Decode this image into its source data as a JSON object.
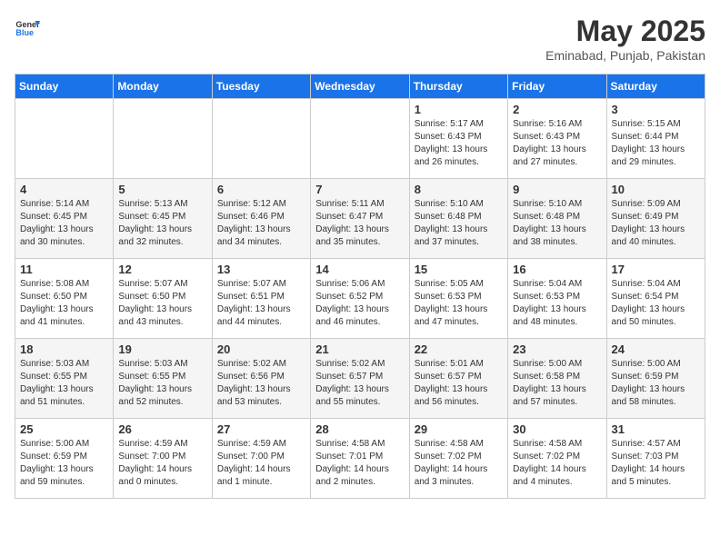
{
  "header": {
    "logo_line1": "General",
    "logo_line2": "Blue",
    "month": "May 2025",
    "location": "Eminabad, Punjab, Pakistan"
  },
  "weekdays": [
    "Sunday",
    "Monday",
    "Tuesday",
    "Wednesday",
    "Thursday",
    "Friday",
    "Saturday"
  ],
  "weeks": [
    [
      {
        "day": "",
        "info": ""
      },
      {
        "day": "",
        "info": ""
      },
      {
        "day": "",
        "info": ""
      },
      {
        "day": "",
        "info": ""
      },
      {
        "day": "1",
        "info": "Sunrise: 5:17 AM\nSunset: 6:43 PM\nDaylight: 13 hours\nand 26 minutes."
      },
      {
        "day": "2",
        "info": "Sunrise: 5:16 AM\nSunset: 6:43 PM\nDaylight: 13 hours\nand 27 minutes."
      },
      {
        "day": "3",
        "info": "Sunrise: 5:15 AM\nSunset: 6:44 PM\nDaylight: 13 hours\nand 29 minutes."
      }
    ],
    [
      {
        "day": "4",
        "info": "Sunrise: 5:14 AM\nSunset: 6:45 PM\nDaylight: 13 hours\nand 30 minutes."
      },
      {
        "day": "5",
        "info": "Sunrise: 5:13 AM\nSunset: 6:45 PM\nDaylight: 13 hours\nand 32 minutes."
      },
      {
        "day": "6",
        "info": "Sunrise: 5:12 AM\nSunset: 6:46 PM\nDaylight: 13 hours\nand 34 minutes."
      },
      {
        "day": "7",
        "info": "Sunrise: 5:11 AM\nSunset: 6:47 PM\nDaylight: 13 hours\nand 35 minutes."
      },
      {
        "day": "8",
        "info": "Sunrise: 5:10 AM\nSunset: 6:48 PM\nDaylight: 13 hours\nand 37 minutes."
      },
      {
        "day": "9",
        "info": "Sunrise: 5:10 AM\nSunset: 6:48 PM\nDaylight: 13 hours\nand 38 minutes."
      },
      {
        "day": "10",
        "info": "Sunrise: 5:09 AM\nSunset: 6:49 PM\nDaylight: 13 hours\nand 40 minutes."
      }
    ],
    [
      {
        "day": "11",
        "info": "Sunrise: 5:08 AM\nSunset: 6:50 PM\nDaylight: 13 hours\nand 41 minutes."
      },
      {
        "day": "12",
        "info": "Sunrise: 5:07 AM\nSunset: 6:50 PM\nDaylight: 13 hours\nand 43 minutes."
      },
      {
        "day": "13",
        "info": "Sunrise: 5:07 AM\nSunset: 6:51 PM\nDaylight: 13 hours\nand 44 minutes."
      },
      {
        "day": "14",
        "info": "Sunrise: 5:06 AM\nSunset: 6:52 PM\nDaylight: 13 hours\nand 46 minutes."
      },
      {
        "day": "15",
        "info": "Sunrise: 5:05 AM\nSunset: 6:53 PM\nDaylight: 13 hours\nand 47 minutes."
      },
      {
        "day": "16",
        "info": "Sunrise: 5:04 AM\nSunset: 6:53 PM\nDaylight: 13 hours\nand 48 minutes."
      },
      {
        "day": "17",
        "info": "Sunrise: 5:04 AM\nSunset: 6:54 PM\nDaylight: 13 hours\nand 50 minutes."
      }
    ],
    [
      {
        "day": "18",
        "info": "Sunrise: 5:03 AM\nSunset: 6:55 PM\nDaylight: 13 hours\nand 51 minutes."
      },
      {
        "day": "19",
        "info": "Sunrise: 5:03 AM\nSunset: 6:55 PM\nDaylight: 13 hours\nand 52 minutes."
      },
      {
        "day": "20",
        "info": "Sunrise: 5:02 AM\nSunset: 6:56 PM\nDaylight: 13 hours\nand 53 minutes."
      },
      {
        "day": "21",
        "info": "Sunrise: 5:02 AM\nSunset: 6:57 PM\nDaylight: 13 hours\nand 55 minutes."
      },
      {
        "day": "22",
        "info": "Sunrise: 5:01 AM\nSunset: 6:57 PM\nDaylight: 13 hours\nand 56 minutes."
      },
      {
        "day": "23",
        "info": "Sunrise: 5:00 AM\nSunset: 6:58 PM\nDaylight: 13 hours\nand 57 minutes."
      },
      {
        "day": "24",
        "info": "Sunrise: 5:00 AM\nSunset: 6:59 PM\nDaylight: 13 hours\nand 58 minutes."
      }
    ],
    [
      {
        "day": "25",
        "info": "Sunrise: 5:00 AM\nSunset: 6:59 PM\nDaylight: 13 hours\nand 59 minutes."
      },
      {
        "day": "26",
        "info": "Sunrise: 4:59 AM\nSunset: 7:00 PM\nDaylight: 14 hours\nand 0 minutes."
      },
      {
        "day": "27",
        "info": "Sunrise: 4:59 AM\nSunset: 7:00 PM\nDaylight: 14 hours\nand 1 minute."
      },
      {
        "day": "28",
        "info": "Sunrise: 4:58 AM\nSunset: 7:01 PM\nDaylight: 14 hours\nand 2 minutes."
      },
      {
        "day": "29",
        "info": "Sunrise: 4:58 AM\nSunset: 7:02 PM\nDaylight: 14 hours\nand 3 minutes."
      },
      {
        "day": "30",
        "info": "Sunrise: 4:58 AM\nSunset: 7:02 PM\nDaylight: 14 hours\nand 4 minutes."
      },
      {
        "day": "31",
        "info": "Sunrise: 4:57 AM\nSunset: 7:03 PM\nDaylight: 14 hours\nand 5 minutes."
      }
    ]
  ]
}
